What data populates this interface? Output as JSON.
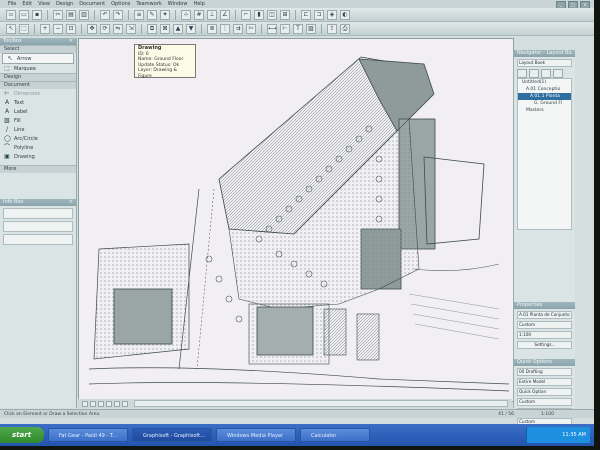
{
  "menu": [
    "File",
    "Edit",
    "View",
    "Design",
    "Document",
    "Options",
    "Teamwork",
    "Window",
    "Help"
  ],
  "tooltip": {
    "title": "Drawing",
    "lines": [
      "ID: 0",
      "Name: Ground Floor",
      "Update Status: Ok",
      "Layer: Drawing & Figure"
    ]
  },
  "toolbox": {
    "header": "Toolbox",
    "select": "Select",
    "arrow": "Arrow",
    "marquee": "Marquee",
    "design": "Design",
    "document_section": "Document",
    "dimension": "Dimension",
    "tools": [
      {
        "icon": "A",
        "label": "Text"
      },
      {
        "icon": "A",
        "label": "Label"
      },
      {
        "icon": "▧",
        "label": "Fill"
      },
      {
        "icon": "/",
        "label": "Line"
      },
      {
        "icon": "◯",
        "label": "Arc/Circle"
      },
      {
        "icon": "⌒",
        "label": "Polyline"
      },
      {
        "icon": "▣",
        "label": "Drawing"
      }
    ],
    "more": "More"
  },
  "infobox": {
    "header": "Info Box"
  },
  "navigator": {
    "header": "Navigator - Layout B...",
    "dropdown": "Layout Book",
    "tree": [
      "Untitled(1)",
      "A.01 Conceptio",
      "A.01.1 Planta",
      "G. Ground Fl",
      "Masters"
    ]
  },
  "properties": {
    "header": "Properties",
    "rows": [
      "A.01  Planta de Conjunto",
      "Custom",
      "1:100"
    ],
    "settings_button": "Settings..."
  },
  "quick_options": {
    "header": "Quick Options",
    "items": [
      "00 Drafting",
      "Entire Model",
      "Quick Option",
      "Custom",
      "Custom",
      "Custom"
    ]
  },
  "statusbar": {
    "hint": "Click an Element or Draw a Selection Area.",
    "zoom": "1:100",
    "pos": "41 / 56"
  },
  "taskbar": {
    "start": "start",
    "tasks": [
      "Fat Gear - Paidi 49 - T...",
      "Graphisoft - Graphisoft...",
      "Windows Media Player",
      "Calculator"
    ],
    "time": "11:35 AM"
  }
}
